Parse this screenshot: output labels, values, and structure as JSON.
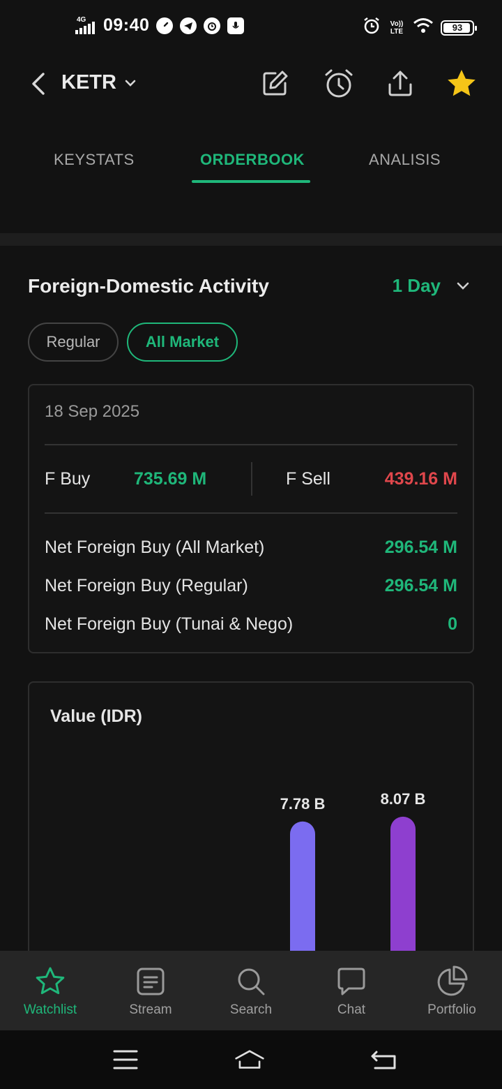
{
  "status_bar": {
    "network": "4G",
    "time": "09:40",
    "volte": "Vo)) LTE",
    "battery": "93"
  },
  "header": {
    "ticker": "KETR"
  },
  "tabs": [
    {
      "label": "KEYSTATS",
      "active": false
    },
    {
      "label": "ORDERBOOK",
      "active": true
    },
    {
      "label": "ANALISIS",
      "active": false
    }
  ],
  "section": {
    "title": "Foreign-Domestic Activity",
    "period": "1 Day",
    "chips": [
      {
        "label": "Regular",
        "selected": false
      },
      {
        "label": "All Market",
        "selected": true
      }
    ]
  },
  "foreign_card": {
    "date": "18 Sep 2025",
    "f_buy_label": "F Buy",
    "f_buy_value": "735.69 M",
    "f_sell_label": "F Sell",
    "f_sell_value": "439.16 M",
    "net_rows": [
      {
        "label": "Net Foreign Buy (All Market)",
        "value": "296.54 M"
      },
      {
        "label": "Net Foreign Buy (Regular)",
        "value": "296.54 M"
      },
      {
        "label": "Net Foreign Buy (Tunai & Nego)",
        "value": "0"
      }
    ]
  },
  "chart_data": {
    "type": "bar",
    "title": "Value (IDR)",
    "categories": [
      "",
      ""
    ],
    "values": [
      7.78,
      8.07
    ],
    "value_labels": [
      "7.78 B",
      "8.07 B"
    ],
    "unit": "B",
    "colors": [
      "#7b6cf0",
      "#8e3fcf"
    ]
  },
  "bottom_nav": [
    {
      "label": "Watchlist",
      "icon": "star-outline-icon",
      "active": true
    },
    {
      "label": "Stream",
      "icon": "stream-icon",
      "active": false
    },
    {
      "label": "Search",
      "icon": "search-icon",
      "active": false
    },
    {
      "label": "Chat",
      "icon": "chat-icon",
      "active": false
    },
    {
      "label": "Portfolio",
      "icon": "pie-chart-icon",
      "active": false
    }
  ],
  "colors": {
    "accent": "#1fb77a",
    "sell": "#e0474c",
    "star": "#f5c518",
    "background": "#121212"
  }
}
